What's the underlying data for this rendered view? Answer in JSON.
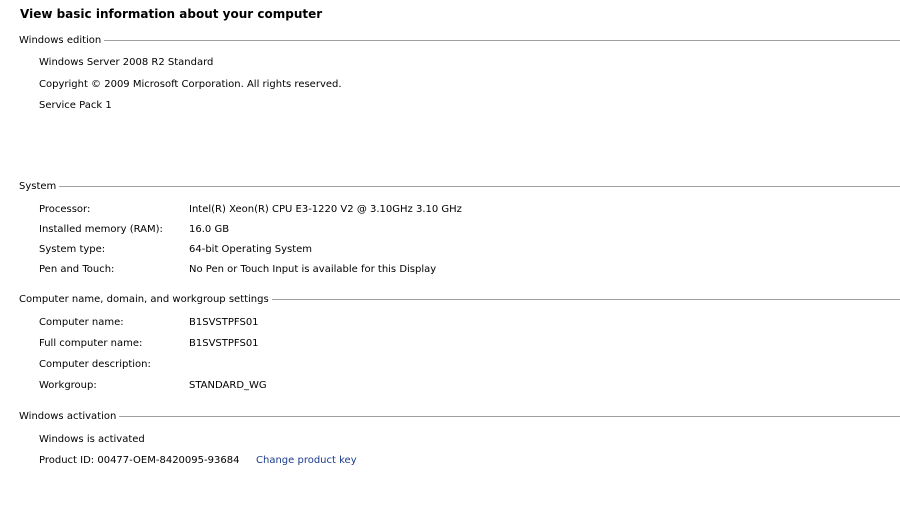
{
  "title": "View basic information about your computer",
  "edition": {
    "header": "Windows edition",
    "name": "Windows Server 2008 R2 Standard",
    "copyright": "Copyright © 2009 Microsoft Corporation.  All rights reserved.",
    "service_pack": "Service Pack 1"
  },
  "system": {
    "header": "System",
    "rows": [
      {
        "label": "Processor:",
        "value": "Intel(R) Xeon(R) CPU E3-1220 V2 @ 3.10GHz   3.10 GHz"
      },
      {
        "label": "Installed memory (RAM):",
        "value": "16.0 GB"
      },
      {
        "label": "System type:",
        "value": "64-bit Operating System"
      },
      {
        "label": "Pen and Touch:",
        "value": "No Pen or Touch Input is available for this Display"
      }
    ]
  },
  "computer_name": {
    "header": "Computer name, domain, and workgroup settings",
    "rows": [
      {
        "label": "Computer name:",
        "value": "B1SVSTPFS01"
      },
      {
        "label": "Full computer name:",
        "value": "B1SVSTPFS01"
      },
      {
        "label": "Computer description:",
        "value": ""
      },
      {
        "label": "Workgroup:",
        "value": "STANDARD_WG"
      }
    ]
  },
  "activation": {
    "header": "Windows activation",
    "status": "Windows is activated",
    "product_id": "Product ID:  00477-OEM-8420095-93684",
    "change_key_link": "Change product key"
  },
  "colors": {
    "link": "#1a3b8c",
    "rule": "#a0a0a0"
  }
}
